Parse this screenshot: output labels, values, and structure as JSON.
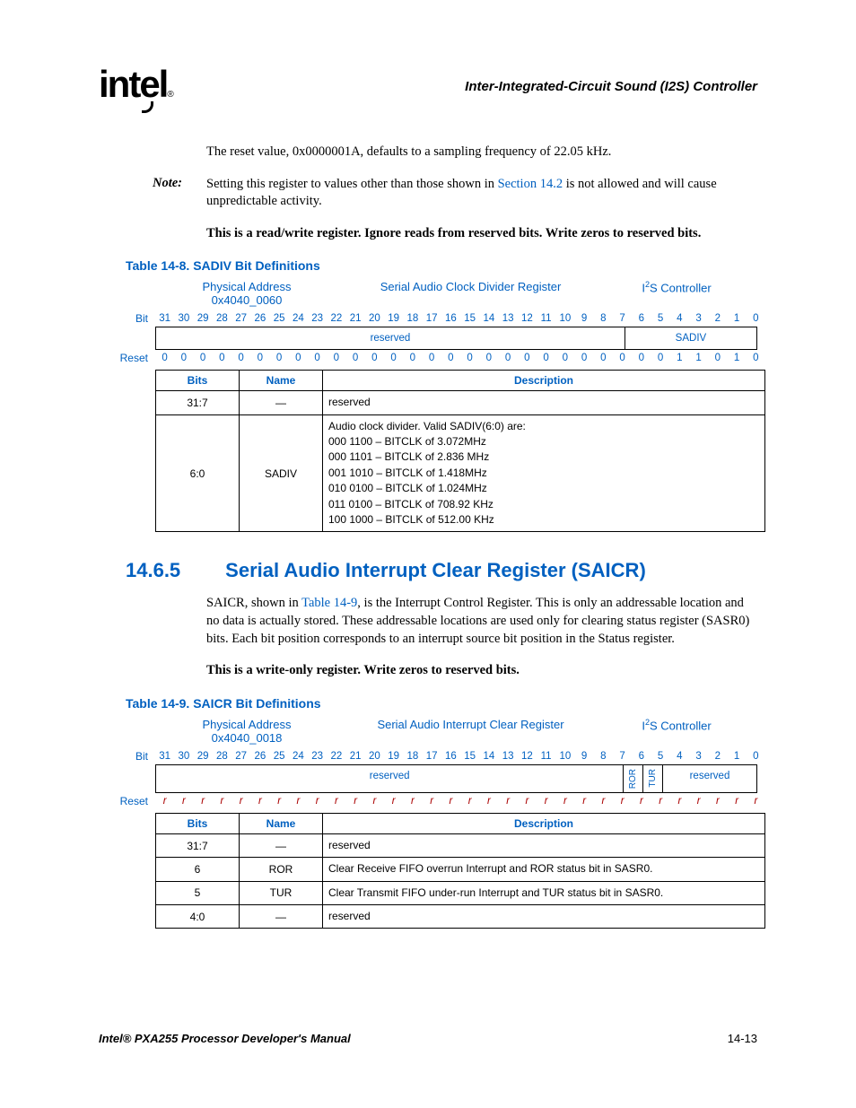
{
  "header": "Inter-Integrated-Circuit Sound (I2S) Controller",
  "logo": "intel",
  "para1": "The reset value, 0x0000001A, defaults to a sampling frequency of 22.05 kHz.",
  "note_label": "Note:",
  "note_pre": "Setting this register to values other than those shown in ",
  "note_link": "Section 14.2",
  "note_post": " is not allowed and will cause unpredictable activity.",
  "para2": "This is a read/write register. Ignore reads from reserved bits. Write zeros to reserved bits.",
  "table8_caption": "Table 14-8. SADIV Bit Definitions",
  "t8": {
    "phys_label": "Physical Address",
    "phys_addr": "0x4040_0060",
    "reg_name": "Serial Audio Clock Divider Register",
    "ctrl_pre": "I",
    "ctrl_post": "S Controller",
    "bit_label": "Bit",
    "reset_label": "Reset",
    "bits": [
      "31",
      "30",
      "29",
      "28",
      "27",
      "26",
      "25",
      "24",
      "23",
      "22",
      "21",
      "20",
      "19",
      "18",
      "17",
      "16",
      "15",
      "14",
      "13",
      "12",
      "11",
      "10",
      "9",
      "8",
      "7",
      "6",
      "5",
      "4",
      "3",
      "2",
      "1",
      "0"
    ],
    "names": {
      "reserved": "reserved",
      "sadiv": "SADIV"
    },
    "resets": [
      "0",
      "0",
      "0",
      "0",
      "0",
      "0",
      "0",
      "0",
      "0",
      "0",
      "0",
      "0",
      "0",
      "0",
      "0",
      "0",
      "0",
      "0",
      "0",
      "0",
      "0",
      "0",
      "0",
      "0",
      "0",
      "0",
      "0",
      "1",
      "1",
      "0",
      "1",
      "0"
    ],
    "th_bits": "Bits",
    "th_name": "Name",
    "th_desc": "Description",
    "rows": [
      {
        "bits": "31:7",
        "name": "—",
        "desc": [
          "reserved"
        ]
      },
      {
        "bits": "6:0",
        "name": "SADIV",
        "desc": [
          "Audio clock divider. Valid SADIV(6:0) are:",
          "000 1100 – BITCLK of 3.072MHz",
          "000 1101 – BITCLK of 2.836 MHz",
          "001 1010 – BITCLK of 1.418MHz",
          "010 0100 – BITCLK of 1.024MHz",
          "011 0100 – BITCLK of 708.92 KHz",
          "100 1000 – BITCLK of 512.00 KHz"
        ]
      }
    ]
  },
  "sec_num": "14.6.5",
  "sec_title": "Serial Audio Interrupt Clear Register (SAICR)",
  "para3_pre": "SAICR, shown in ",
  "para3_link": "Table 14-9",
  "para3_post": ", is the Interrupt Control Register. This is only an addressable location and no data is actually stored. These addressable locations are used only for clearing status register (SASR0) bits. Each bit position corresponds to an interrupt source bit position in the Status register.",
  "para4": "This is a write-only register. Write zeros to reserved bits.",
  "table9_caption": "Table 14-9. SAICR Bit Definitions",
  "t9": {
    "phys_label": "Physical Address",
    "phys_addr": "0x4040_0018",
    "reg_name": "Serial Audio Interrupt Clear Register",
    "ctrl_pre": "I",
    "ctrl_post": "S Controller",
    "bit_label": "Bit",
    "reset_label": "Reset",
    "bits": [
      "31",
      "30",
      "29",
      "28",
      "27",
      "26",
      "25",
      "24",
      "23",
      "22",
      "21",
      "20",
      "19",
      "18",
      "17",
      "16",
      "15",
      "14",
      "13",
      "12",
      "11",
      "10",
      "9",
      "8",
      "7",
      "6",
      "5",
      "4",
      "3",
      "2",
      "1",
      "0"
    ],
    "names": {
      "reserved": "reserved",
      "ror": "ROR",
      "tur": "TUR",
      "reserved2": "reserved"
    },
    "reset_r": "r",
    "th_bits": "Bits",
    "th_name": "Name",
    "th_desc": "Description",
    "rows": [
      {
        "bits": "31:7",
        "name": "—",
        "desc": [
          "reserved"
        ]
      },
      {
        "bits": "6",
        "name": "ROR",
        "desc": [
          "Clear Receive FIFO overrun Interrupt and ROR status bit in SASR0."
        ]
      },
      {
        "bits": "5",
        "name": "TUR",
        "desc": [
          "Clear Transmit FIFO under-run Interrupt and TUR status bit in SASR0."
        ]
      },
      {
        "bits": "4:0",
        "name": "—",
        "desc": [
          "reserved"
        ]
      }
    ]
  },
  "footer_left": "Intel® PXA255 Processor Developer's Manual",
  "footer_right": "14-13"
}
